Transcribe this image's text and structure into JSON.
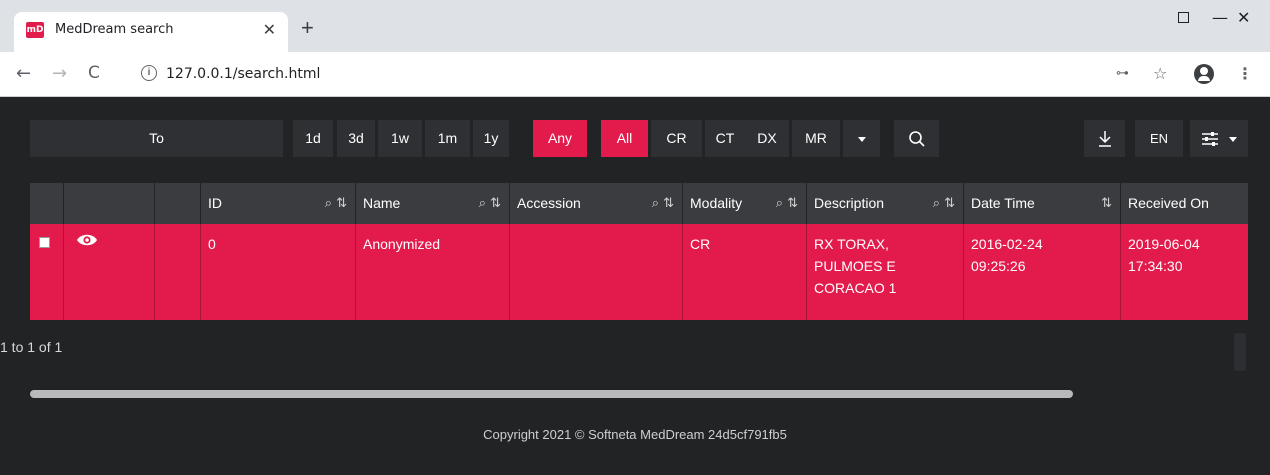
{
  "browser": {
    "tab_title": "MedDream search",
    "favicon_text": "mD",
    "url": "127.0.0.1/search.html",
    "new_tab_label": "+",
    "close_tab_label": "✕"
  },
  "toolbar": {
    "to_label": "To",
    "date_filters": [
      "1d",
      "3d",
      "1w",
      "1m",
      "1y",
      "Any"
    ],
    "active_date_filter": "Any",
    "modality_filters": [
      "All",
      "CR",
      "CT",
      "DX",
      "MR"
    ],
    "active_modality_filter": "All",
    "language": "EN"
  },
  "table": {
    "columns": [
      "ID",
      "Name",
      "Accession",
      "Modality",
      "Description",
      "Date Time",
      "Received On"
    ],
    "rows": [
      {
        "id": "0",
        "name": "Anonymized",
        "accession": "",
        "modality": "CR",
        "description": [
          "RX TORAX,",
          "PULMOES E",
          "CORACAO 1"
        ],
        "date_time": [
          "2016-02-24",
          "09:25:26"
        ],
        "received_on": [
          "2019-06-04",
          "17:34:30"
        ]
      }
    ]
  },
  "pager_text": "1 to 1 of 1",
  "footer": "Copyright 2021 © Softneta MedDream 24d5cf791fb5",
  "colors": {
    "accent": "#e31b4c",
    "background": "#222325",
    "button_bg": "#2e3033",
    "header_bg": "#3a3c40"
  }
}
